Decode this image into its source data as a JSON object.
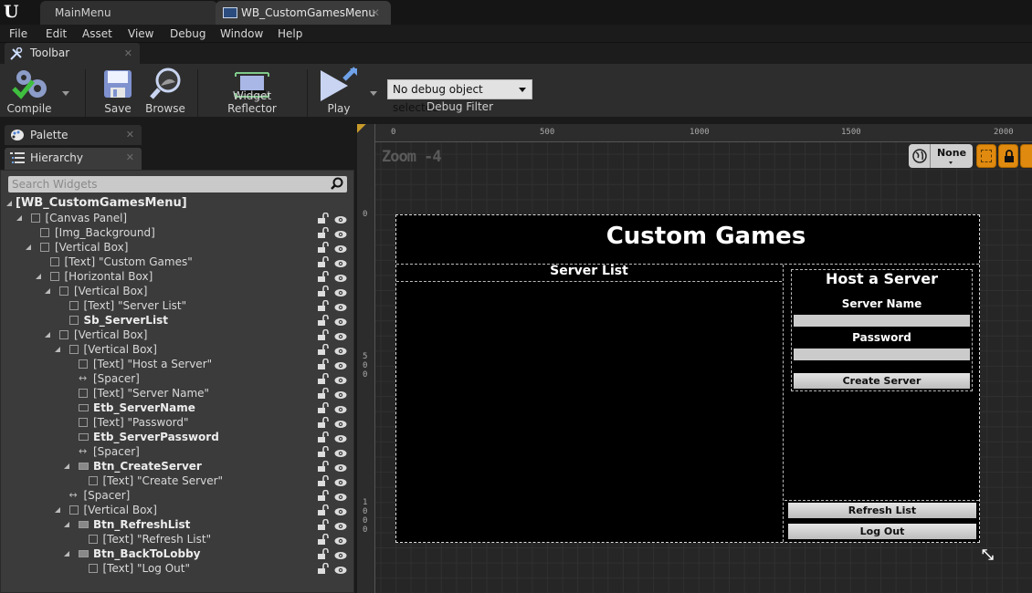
{
  "tabs": [
    {
      "label": "MainMenu",
      "active": false
    },
    {
      "label": "WB_CustomGamesMenu",
      "active": true
    }
  ],
  "menu": [
    "File",
    "Edit",
    "Asset",
    "View",
    "Debug",
    "Window",
    "Help"
  ],
  "toolbar": {
    "tab_label": "Toolbar",
    "compile": "Compile",
    "save": "Save",
    "browse": "Browse",
    "widget_reflector": "Widget Reflector",
    "play": "Play",
    "debug_select": "No debug object selected",
    "debug_filter": "Debug Filter"
  },
  "panels": {
    "palette": "Palette",
    "hierarchy": "Hierarchy",
    "search_placeholder": "Search Widgets"
  },
  "hierarchy": [
    {
      "label": "[WB_CustomGamesMenu]",
      "depth": 0,
      "bold": true,
      "expanded": true,
      "icon": "none",
      "controls": false
    },
    {
      "label": "[Canvas Panel]",
      "depth": 1,
      "bold": false,
      "expanded": true,
      "icon": "canvas-panel-icon",
      "controls": true
    },
    {
      "label": "[Img_Background]",
      "depth": 2,
      "bold": false,
      "expanded": null,
      "icon": "image-icon",
      "controls": true
    },
    {
      "label": "[Vertical Box]",
      "depth": 2,
      "bold": false,
      "expanded": true,
      "icon": "vertical-box-icon",
      "controls": true
    },
    {
      "label": "[Text] \"Custom Games\"",
      "depth": 3,
      "bold": false,
      "expanded": null,
      "icon": "text-icon",
      "controls": true
    },
    {
      "label": "[Horizontal Box]",
      "depth": 3,
      "bold": false,
      "expanded": true,
      "icon": "horizontal-box-icon",
      "controls": true
    },
    {
      "label": "[Vertical Box]",
      "depth": 4,
      "bold": false,
      "expanded": true,
      "icon": "vertical-box-icon",
      "controls": true
    },
    {
      "label": "[Text] \"Server List\"",
      "depth": 5,
      "bold": false,
      "expanded": null,
      "icon": "text-icon",
      "controls": true
    },
    {
      "label": "Sb_ServerList",
      "depth": 5,
      "bold": true,
      "expanded": null,
      "icon": "scroll-box-icon",
      "controls": true
    },
    {
      "label": "[Vertical Box]",
      "depth": 4,
      "bold": false,
      "expanded": true,
      "icon": "vertical-box-icon",
      "controls": true
    },
    {
      "label": "[Vertical Box]",
      "depth": 5,
      "bold": false,
      "expanded": true,
      "icon": "vertical-box-icon",
      "controls": true
    },
    {
      "label": "[Text] \"Host a Server\"",
      "depth": 6,
      "bold": false,
      "expanded": null,
      "icon": "text-icon",
      "controls": true
    },
    {
      "label": "[Spacer]",
      "depth": 6,
      "bold": false,
      "expanded": null,
      "icon": "spacer-icon",
      "controls": true
    },
    {
      "label": "[Text] \"Server Name\"",
      "depth": 6,
      "bold": false,
      "expanded": null,
      "icon": "text-icon",
      "controls": true
    },
    {
      "label": "Etb_ServerName",
      "depth": 6,
      "bold": true,
      "expanded": null,
      "icon": "text-box-icon",
      "controls": true
    },
    {
      "label": "[Text] \"Password\"",
      "depth": 6,
      "bold": false,
      "expanded": null,
      "icon": "text-icon",
      "controls": true
    },
    {
      "label": "Etb_ServerPassword",
      "depth": 6,
      "bold": true,
      "expanded": null,
      "icon": "text-box-icon",
      "controls": true
    },
    {
      "label": "[Spacer]",
      "depth": 6,
      "bold": false,
      "expanded": null,
      "icon": "spacer-icon",
      "controls": true
    },
    {
      "label": "Btn_CreateServer",
      "depth": 6,
      "bold": true,
      "expanded": true,
      "icon": "button-icon",
      "controls": true
    },
    {
      "label": "[Text] \"Create Server\"",
      "depth": 7,
      "bold": false,
      "expanded": null,
      "icon": "text-icon",
      "controls": true
    },
    {
      "label": "[Spacer]",
      "depth": 5,
      "bold": false,
      "expanded": null,
      "icon": "spacer-icon",
      "controls": true
    },
    {
      "label": "[Vertical Box]",
      "depth": 5,
      "bold": false,
      "expanded": true,
      "icon": "vertical-box-icon",
      "controls": true
    },
    {
      "label": "Btn_RefreshList",
      "depth": 6,
      "bold": true,
      "expanded": true,
      "icon": "button-icon",
      "controls": true
    },
    {
      "label": "[Text] \"Refresh List\"",
      "depth": 7,
      "bold": false,
      "expanded": null,
      "icon": "text-icon",
      "controls": true
    },
    {
      "label": "Btn_BackToLobby",
      "depth": 6,
      "bold": true,
      "expanded": true,
      "icon": "button-icon",
      "controls": true
    },
    {
      "label": "[Text] \"Log Out\"",
      "depth": 7,
      "bold": false,
      "expanded": null,
      "icon": "text-icon",
      "controls": true
    }
  ],
  "designer": {
    "zoom_label": "Zoom -4",
    "ruler_top": [
      "0",
      "500",
      "1000",
      "1500",
      "2000"
    ],
    "ruler_left": [
      "0",
      "500",
      "1000"
    ],
    "dpi_selector": "None",
    "widget": {
      "title": "Custom Games",
      "server_list_title": "Server List",
      "host_title": "Host a Server",
      "server_name_label": "Server Name",
      "server_name_value": "",
      "password_label": "Password",
      "password_value": "",
      "create_server": "Create Server",
      "refresh_list": "Refresh List",
      "log_out": "Log Out"
    }
  },
  "colors": {
    "accent_orange": "#e08a10",
    "canvas_bg": "#000000",
    "panel_bg": "#3b3b3b"
  }
}
